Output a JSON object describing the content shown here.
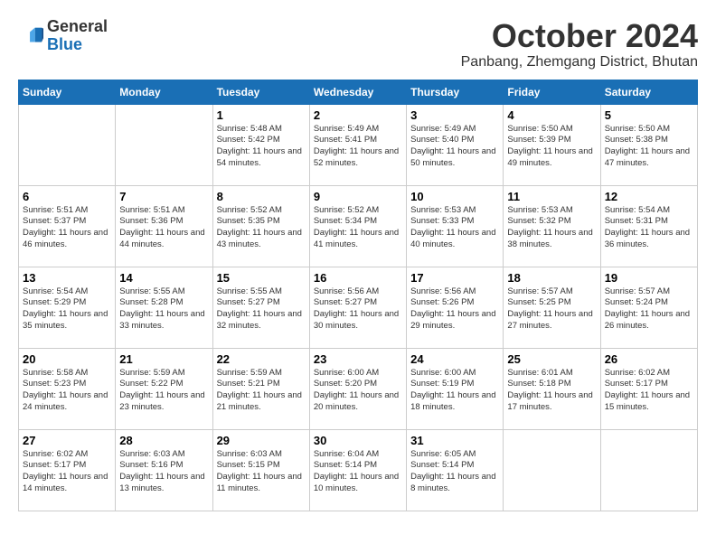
{
  "header": {
    "logo_general": "General",
    "logo_blue": "Blue",
    "month_title": "October 2024",
    "subtitle": "Panbang, Zhemgang District, Bhutan"
  },
  "calendar": {
    "days_of_week": [
      "Sunday",
      "Monday",
      "Tuesday",
      "Wednesday",
      "Thursday",
      "Friday",
      "Saturday"
    ],
    "weeks": [
      [
        {
          "day": "",
          "info": ""
        },
        {
          "day": "",
          "info": ""
        },
        {
          "day": "1",
          "info": "Sunrise: 5:48 AM\nSunset: 5:42 PM\nDaylight: 11 hours\nand 54 minutes."
        },
        {
          "day": "2",
          "info": "Sunrise: 5:49 AM\nSunset: 5:41 PM\nDaylight: 11 hours\nand 52 minutes."
        },
        {
          "day": "3",
          "info": "Sunrise: 5:49 AM\nSunset: 5:40 PM\nDaylight: 11 hours\nand 50 minutes."
        },
        {
          "day": "4",
          "info": "Sunrise: 5:50 AM\nSunset: 5:39 PM\nDaylight: 11 hours\nand 49 minutes."
        },
        {
          "day": "5",
          "info": "Sunrise: 5:50 AM\nSunset: 5:38 PM\nDaylight: 11 hours\nand 47 minutes."
        }
      ],
      [
        {
          "day": "6",
          "info": "Sunrise: 5:51 AM\nSunset: 5:37 PM\nDaylight: 11 hours\nand 46 minutes."
        },
        {
          "day": "7",
          "info": "Sunrise: 5:51 AM\nSunset: 5:36 PM\nDaylight: 11 hours\nand 44 minutes."
        },
        {
          "day": "8",
          "info": "Sunrise: 5:52 AM\nSunset: 5:35 PM\nDaylight: 11 hours\nand 43 minutes."
        },
        {
          "day": "9",
          "info": "Sunrise: 5:52 AM\nSunset: 5:34 PM\nDaylight: 11 hours\nand 41 minutes."
        },
        {
          "day": "10",
          "info": "Sunrise: 5:53 AM\nSunset: 5:33 PM\nDaylight: 11 hours\nand 40 minutes."
        },
        {
          "day": "11",
          "info": "Sunrise: 5:53 AM\nSunset: 5:32 PM\nDaylight: 11 hours\nand 38 minutes."
        },
        {
          "day": "12",
          "info": "Sunrise: 5:54 AM\nSunset: 5:31 PM\nDaylight: 11 hours\nand 36 minutes."
        }
      ],
      [
        {
          "day": "13",
          "info": "Sunrise: 5:54 AM\nSunset: 5:29 PM\nDaylight: 11 hours\nand 35 minutes."
        },
        {
          "day": "14",
          "info": "Sunrise: 5:55 AM\nSunset: 5:28 PM\nDaylight: 11 hours\nand 33 minutes."
        },
        {
          "day": "15",
          "info": "Sunrise: 5:55 AM\nSunset: 5:27 PM\nDaylight: 11 hours\nand 32 minutes."
        },
        {
          "day": "16",
          "info": "Sunrise: 5:56 AM\nSunset: 5:27 PM\nDaylight: 11 hours\nand 30 minutes."
        },
        {
          "day": "17",
          "info": "Sunrise: 5:56 AM\nSunset: 5:26 PM\nDaylight: 11 hours\nand 29 minutes."
        },
        {
          "day": "18",
          "info": "Sunrise: 5:57 AM\nSunset: 5:25 PM\nDaylight: 11 hours\nand 27 minutes."
        },
        {
          "day": "19",
          "info": "Sunrise: 5:57 AM\nSunset: 5:24 PM\nDaylight: 11 hours\nand 26 minutes."
        }
      ],
      [
        {
          "day": "20",
          "info": "Sunrise: 5:58 AM\nSunset: 5:23 PM\nDaylight: 11 hours\nand 24 minutes."
        },
        {
          "day": "21",
          "info": "Sunrise: 5:59 AM\nSunset: 5:22 PM\nDaylight: 11 hours\nand 23 minutes."
        },
        {
          "day": "22",
          "info": "Sunrise: 5:59 AM\nSunset: 5:21 PM\nDaylight: 11 hours\nand 21 minutes."
        },
        {
          "day": "23",
          "info": "Sunrise: 6:00 AM\nSunset: 5:20 PM\nDaylight: 11 hours\nand 20 minutes."
        },
        {
          "day": "24",
          "info": "Sunrise: 6:00 AM\nSunset: 5:19 PM\nDaylight: 11 hours\nand 18 minutes."
        },
        {
          "day": "25",
          "info": "Sunrise: 6:01 AM\nSunset: 5:18 PM\nDaylight: 11 hours\nand 17 minutes."
        },
        {
          "day": "26",
          "info": "Sunrise: 6:02 AM\nSunset: 5:17 PM\nDaylight: 11 hours\nand 15 minutes."
        }
      ],
      [
        {
          "day": "27",
          "info": "Sunrise: 6:02 AM\nSunset: 5:17 PM\nDaylight: 11 hours\nand 14 minutes."
        },
        {
          "day": "28",
          "info": "Sunrise: 6:03 AM\nSunset: 5:16 PM\nDaylight: 11 hours\nand 13 minutes."
        },
        {
          "day": "29",
          "info": "Sunrise: 6:03 AM\nSunset: 5:15 PM\nDaylight: 11 hours\nand 11 minutes."
        },
        {
          "day": "30",
          "info": "Sunrise: 6:04 AM\nSunset: 5:14 PM\nDaylight: 11 hours\nand 10 minutes."
        },
        {
          "day": "31",
          "info": "Sunrise: 6:05 AM\nSunset: 5:14 PM\nDaylight: 11 hours\nand 8 minutes."
        },
        {
          "day": "",
          "info": ""
        },
        {
          "day": "",
          "info": ""
        }
      ]
    ]
  }
}
